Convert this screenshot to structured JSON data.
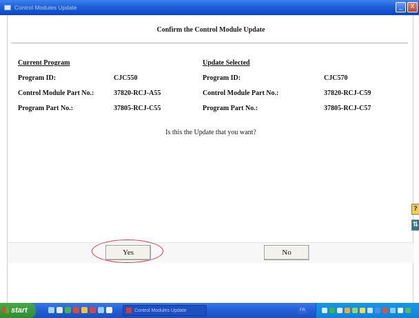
{
  "window": {
    "title": "Control Modules Update",
    "controls": {
      "minimize": "_",
      "close": "X"
    }
  },
  "dialog": {
    "heading": "Confirm the Control Module Update",
    "current": {
      "header": "Current Program",
      "rows": [
        {
          "label": "Program ID:",
          "value": "CJC550"
        },
        {
          "label": "Control Module Part No.:",
          "value": "37820-RCJ-A55"
        },
        {
          "label": "Program Part No.:",
          "value": "37805-RCJ-C55"
        }
      ]
    },
    "update": {
      "header": "Update Selected",
      "rows": [
        {
          "label": "Program ID:",
          "value": "CJC570"
        },
        {
          "label": "Control Module Part No.:",
          "value": "37820-RCJ-C59"
        },
        {
          "label": "Program Part No.:",
          "value": "37805-RCJ-C57"
        }
      ]
    },
    "question": "Is this the Update that you want?",
    "buttons": {
      "yes": "Yes",
      "no": "No"
    }
  },
  "side_icons": {
    "help": "?",
    "tool": "⇅"
  },
  "taskbar": {
    "start_label": "start",
    "active_task": "Control Modules Update",
    "language": "FR"
  },
  "colors": {
    "titlebar": "#1f5fd6",
    "highlight_ellipse": "#d83a3a",
    "taskbar": "#245edb",
    "start_button": "#2f8c30"
  }
}
